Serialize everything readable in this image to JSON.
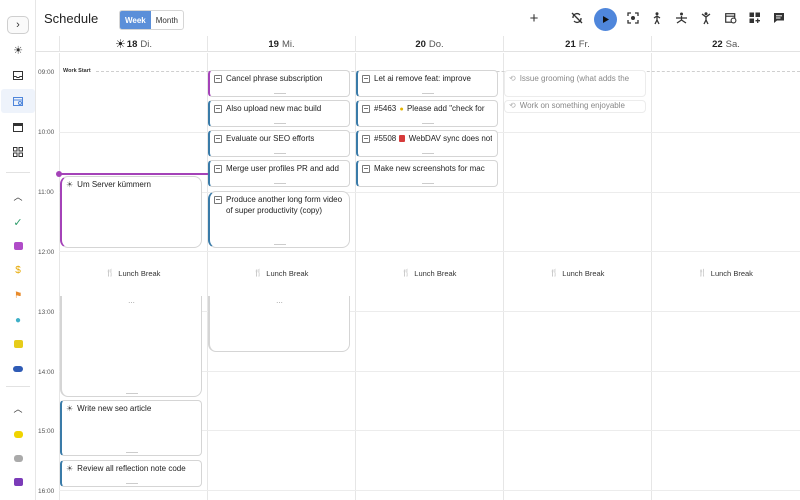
{
  "header": {
    "title": "Schedule",
    "views": [
      "Week",
      "Month"
    ],
    "active_view": "Week",
    "icons": [
      "add-icon",
      "sync-off-icon",
      "play-icon",
      "focus-icon",
      "walk-icon",
      "yoga-icon",
      "person-icon",
      "calendar-clock-icon",
      "dashboard-add-icon",
      "chat-icon"
    ]
  },
  "days": [
    {
      "num": "18",
      "name": "Di.",
      "today": true
    },
    {
      "num": "19",
      "name": "Mi."
    },
    {
      "num": "20",
      "name": "Do."
    },
    {
      "num": "21",
      "name": "Fr."
    },
    {
      "num": "22",
      "name": "Sa."
    }
  ],
  "hours": [
    "09:00",
    "10:00",
    "11:00",
    "12:00",
    "13:00",
    "14:00",
    "15:00",
    "16:00"
  ],
  "work_start": "Work Start",
  "lunch_label": "Lunch Break",
  "events": {
    "d18": [
      {
        "title": "Um Server kümmern"
      },
      {
        "title": "Write new seo article"
      },
      {
        "title": "Review all reflection note code"
      }
    ],
    "d19": [
      {
        "title": "Cancel phrase subscription"
      },
      {
        "title": "Also upload new mac build"
      },
      {
        "title": "Evaluate our SEO efforts"
      },
      {
        "title": "Merge user profiles PR and add"
      },
      {
        "title": "Produce another long form video of super productivity (copy)"
      }
    ],
    "d20": [
      {
        "title": "Let ai remove feat: improve"
      },
      {
        "pre": "#5463",
        "title": "Please add \"check for"
      },
      {
        "pre": "#5508",
        "title": "WebDAV sync does not"
      },
      {
        "title": "Make new screenshots for mac"
      }
    ],
    "d21": [
      {
        "title": "Issue grooming (what adds the"
      },
      {
        "title": "Work on something enjoyable"
      }
    ]
  },
  "ellipsis": "...",
  "colors": {
    "accent": "#4f86db",
    "now": "#a442b8",
    "task_border": "#3a7ba8"
  }
}
